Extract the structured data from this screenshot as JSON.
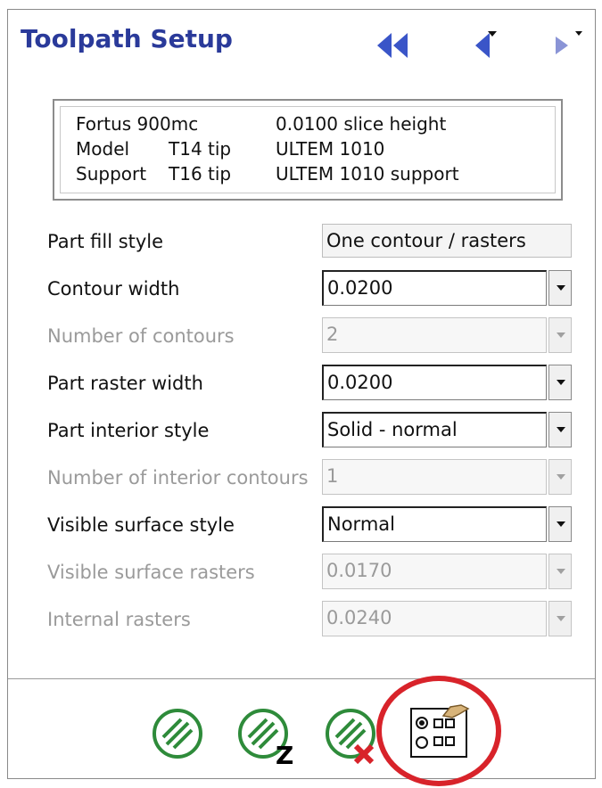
{
  "header": {
    "title": "Toolpath Setup",
    "nav_icons": [
      "rewind-double-left-icon",
      "step-back-icon",
      "step-forward-icon"
    ]
  },
  "info": {
    "printer": "Fortus 900mc",
    "slice": "0.0100 slice height",
    "model_label": "Model",
    "model_tip": "T14 tip",
    "model_material": "ULTEM 1010",
    "support_label": "Support",
    "support_tip": "T16 tip",
    "support_material": "ULTEM 1010 support"
  },
  "settings": [
    {
      "label": "Part fill style",
      "value": "One contour / rasters",
      "enabled": true
    },
    {
      "label": "Contour width",
      "value": "0.0200",
      "enabled": true
    },
    {
      "label": "Number of contours",
      "value": "2",
      "enabled": false
    },
    {
      "label": "Part raster width",
      "value": "0.0200",
      "enabled": true
    },
    {
      "label": "Part interior style",
      "value": "Solid - normal",
      "enabled": true
    },
    {
      "label": "Number of interior contours",
      "value": "1",
      "enabled": false
    },
    {
      "label": "Visible surface style",
      "value": "Normal",
      "enabled": true
    },
    {
      "label": "Visible surface rasters",
      "value": "0.0170",
      "enabled": false
    },
    {
      "label": "Internal rasters",
      "value": "0.0240",
      "enabled": false
    }
  ],
  "toolbar": {
    "z_badge": "Z",
    "icons": [
      "toolpath-icon",
      "toolpath-z-icon",
      "toolpath-delete-icon",
      "custom-groups-icon"
    ],
    "highlight_color": "#d8232a"
  },
  "colors": {
    "title": "#2a3a9a",
    "nav": "#3a55c8",
    "toolpath_green": "#2e8b3a"
  }
}
